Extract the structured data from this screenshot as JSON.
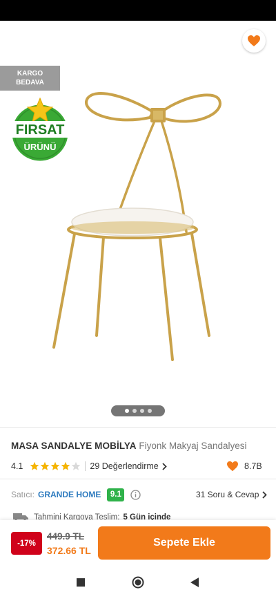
{
  "badges": {
    "shipping_line1": "KARGO",
    "shipping_line2": "BEDAVA",
    "deal_line1": "FIRSAT",
    "deal_line2": "ÜRÜNÜ"
  },
  "product": {
    "brand": "MASA SANDALYE MOBİLYA",
    "name": "Fiyonk Makyaj Sandalyesi",
    "rating": "4.1",
    "stars_filled": 4,
    "review_count_label": "29 Değerlendirme",
    "favorite_count": "8.7B"
  },
  "seller": {
    "label": "Satıcı:",
    "name": "GRANDE HOME",
    "score": "9.1",
    "qa_label": "31 Soru & Cevap"
  },
  "delivery": {
    "label": "Tahmini Kargoya Teslim:",
    "value": "5 Gün içinde"
  },
  "pricing": {
    "discount": "-17%",
    "old_price": "449.9 TL",
    "new_price": "372.66 TL",
    "add_to_cart": "Sepete Ekle"
  },
  "gallery": {
    "page_count": 4,
    "active_index": 0
  },
  "colors": {
    "accent": "#f27a1a",
    "seller_score": "#2fb24a",
    "discount": "#d0021b",
    "chair_gold": "#c9a24a",
    "seller_link": "#2e7bbf"
  }
}
